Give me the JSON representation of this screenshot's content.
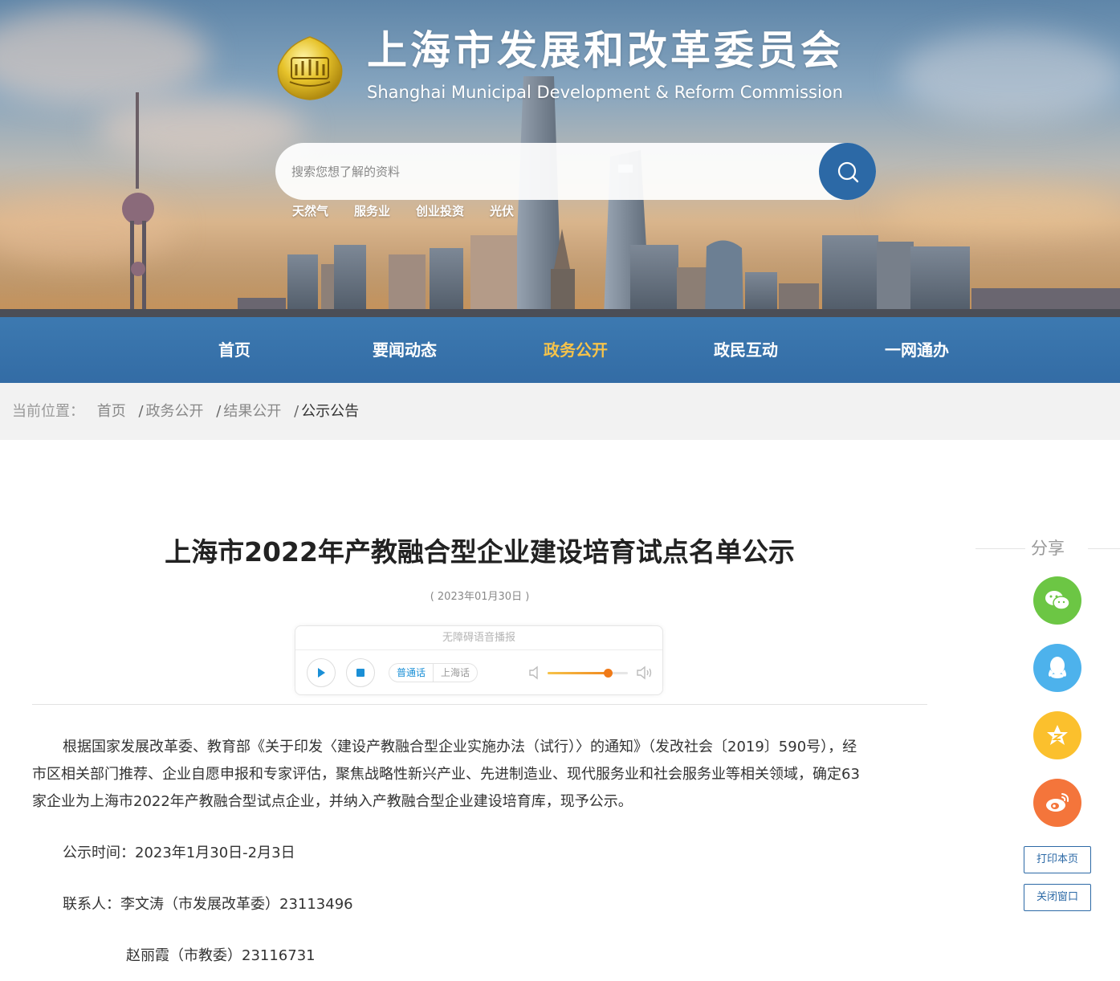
{
  "header": {
    "title": "上海市发展和改革委员会",
    "subtitle": "Shanghai Municipal Development & Reform Commission",
    "logo_icon": "municipal-emblem",
    "search_placeholder": "搜索您想了解的资料",
    "search_icon": "search-icon",
    "hot_words": [
      "天然气",
      "服务业",
      "创业投资",
      "光伏"
    ]
  },
  "nav": {
    "items": [
      "首页",
      "要闻动态",
      "政务公开",
      "政民互动",
      "一网通办"
    ],
    "active": "政务公开",
    "active_color": "#f6c34a",
    "bar_color": "#2c6eaa"
  },
  "breadcrumb": {
    "prefix": "当前位置：",
    "items": [
      "首页",
      "政务公开",
      "结果公开",
      "公示公告"
    ]
  },
  "article": {
    "title": "上海市2022年产教融合型企业建设培育试点名单公示",
    "date": "( 2023年01月30日 )",
    "paragraph_lines": [
      "根据国家发展改革委、教育部《关于印发〈建设产教融合型企业实施办法（试行）〉的通知》（发改社会〔2019〕590号），经",
      "市区相关部门推荐、企业自愿申报和专家评估，聚焦战略性新兴产业、先进制造业、现代服务业和社会服务业等相关领域，确定63",
      "家企业为上海市2022年产教融合型试点企业，并纳入产教融合型企业建设培育库，现予公示。"
    ],
    "publicity_time": "公示时间：2023年1月30日-2月3日",
    "contact_1": "联系人：李文涛（市发展改革委）23113496",
    "contact_2": "赵丽霞（市教委）23116731"
  },
  "audio": {
    "title": "无障碍语音播报",
    "languages": [
      "普通话",
      "上海话"
    ],
    "active_language": "普通话",
    "volume": 0.75,
    "accent_color": "#1a8fd6"
  },
  "share": {
    "label": "分享",
    "buttons": [
      {
        "icon": "wechat-icon",
        "color": "#6cc644"
      },
      {
        "icon": "qq-icon",
        "color": "#4db2ec"
      },
      {
        "icon": "qzone-icon",
        "color": "#fbc02d"
      },
      {
        "icon": "weibo-icon",
        "color": "#f4753b"
      }
    ],
    "print_label": "打印本页",
    "close_label": "关闭窗口"
  }
}
